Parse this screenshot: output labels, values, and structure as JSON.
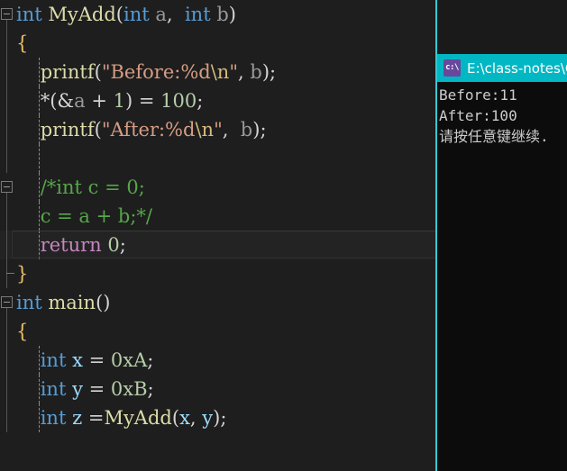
{
  "editor": {
    "name": "visual-studio-code-editor",
    "theme": "dark",
    "background": "#1e1e1e",
    "current_line_number": 9,
    "lines": [
      {
        "id": 1,
        "outline": "collapse",
        "indent_guide": false,
        "current": false,
        "tokens": [
          {
            "t": "int",
            "c": "t-keyword"
          },
          {
            "t": " ",
            "c": "t-plain"
          },
          {
            "t": "MyAdd",
            "c": "t-func"
          },
          {
            "t": "(",
            "c": "t-paren1"
          },
          {
            "t": "int",
            "c": "t-keyword"
          },
          {
            "t": " ",
            "c": "t-plain"
          },
          {
            "t": "a",
            "c": "t-param"
          },
          {
            "t": ",",
            "c": "t-plain"
          },
          {
            "t": "  ",
            "c": "t-plain"
          },
          {
            "t": "int",
            "c": "t-keyword"
          },
          {
            "t": " ",
            "c": "t-plain"
          },
          {
            "t": "b",
            "c": "t-param"
          },
          {
            "t": ")",
            "c": "t-paren1"
          }
        ]
      },
      {
        "id": 2,
        "outline": "line",
        "indent_guide": false,
        "current": false,
        "tokens": [
          {
            "t": "{",
            "c": "t-brace"
          }
        ]
      },
      {
        "id": 3,
        "outline": "line",
        "indent_guide": true,
        "current": false,
        "tokens": [
          {
            "t": "    ",
            "c": "t-plain"
          },
          {
            "t": "printf",
            "c": "t-func"
          },
          {
            "t": "(",
            "c": "t-paren1"
          },
          {
            "t": "\"Before:%d",
            "c": "t-string"
          },
          {
            "t": "\\n",
            "c": "t-escape"
          },
          {
            "t": "\"",
            "c": "t-string"
          },
          {
            "t": ",",
            "c": "t-plain"
          },
          {
            "t": " ",
            "c": "t-plain"
          },
          {
            "t": "b",
            "c": "t-param"
          },
          {
            "t": ")",
            "c": "t-paren1"
          },
          {
            "t": ";",
            "c": "t-plain"
          }
        ]
      },
      {
        "id": 4,
        "outline": "line",
        "indent_guide": true,
        "current": false,
        "tokens": [
          {
            "t": "    ",
            "c": "t-plain"
          },
          {
            "t": "*",
            "c": "t-plain"
          },
          {
            "t": "(",
            "c": "t-paren1"
          },
          {
            "t": "&",
            "c": "t-plain"
          },
          {
            "t": "a",
            "c": "t-param"
          },
          {
            "t": " + ",
            "c": "t-plain"
          },
          {
            "t": "1",
            "c": "t-number"
          },
          {
            "t": ")",
            "c": "t-paren1"
          },
          {
            "t": " = ",
            "c": "t-plain"
          },
          {
            "t": "100",
            "c": "t-number"
          },
          {
            "t": ";",
            "c": "t-plain"
          }
        ]
      },
      {
        "id": 5,
        "outline": "line",
        "indent_guide": true,
        "current": false,
        "tokens": [
          {
            "t": "    ",
            "c": "t-plain"
          },
          {
            "t": "printf",
            "c": "t-func"
          },
          {
            "t": "(",
            "c": "t-paren1"
          },
          {
            "t": "\"After:%d",
            "c": "t-string"
          },
          {
            "t": "\\n",
            "c": "t-escape"
          },
          {
            "t": "\"",
            "c": "t-string"
          },
          {
            "t": ",",
            "c": "t-plain"
          },
          {
            "t": "  ",
            "c": "t-plain"
          },
          {
            "t": "b",
            "c": "t-param"
          },
          {
            "t": ")",
            "c": "t-paren1"
          },
          {
            "t": ";",
            "c": "t-plain"
          }
        ]
      },
      {
        "id": 6,
        "outline": "line",
        "indent_guide": true,
        "current": false,
        "tokens": []
      },
      {
        "id": 7,
        "outline": "collapse",
        "indent_guide": true,
        "current": false,
        "tokens": [
          {
            "t": "    ",
            "c": "t-plain"
          },
          {
            "t": "/*int c = 0;",
            "c": "t-comment"
          }
        ]
      },
      {
        "id": 8,
        "outline": "line",
        "indent_guide": true,
        "current": false,
        "tokens": [
          {
            "t": "    ",
            "c": "t-plain"
          },
          {
            "t": "c = a + b;*/",
            "c": "t-comment"
          }
        ]
      },
      {
        "id": 9,
        "outline": "line",
        "indent_guide": true,
        "current": true,
        "tokens": [
          {
            "t": "    ",
            "c": "t-plain"
          },
          {
            "t": "return",
            "c": "t-ctrl"
          },
          {
            "t": " ",
            "c": "t-plain"
          },
          {
            "t": "0",
            "c": "t-number"
          },
          {
            "t": ";",
            "c": "t-plain"
          }
        ]
      },
      {
        "id": 10,
        "outline": "endbar",
        "indent_guide": false,
        "current": false,
        "tokens": [
          {
            "t": "}",
            "c": "t-brace"
          }
        ]
      },
      {
        "id": 11,
        "outline": "collapse",
        "indent_guide": false,
        "current": false,
        "tokens": [
          {
            "t": "int",
            "c": "t-keyword"
          },
          {
            "t": " ",
            "c": "t-plain"
          },
          {
            "t": "main",
            "c": "t-func"
          },
          {
            "t": "(",
            "c": "t-paren1"
          },
          {
            "t": ")",
            "c": "t-paren1"
          }
        ]
      },
      {
        "id": 12,
        "outline": "line",
        "indent_guide": false,
        "current": false,
        "tokens": [
          {
            "t": "{",
            "c": "t-brace"
          }
        ]
      },
      {
        "id": 13,
        "outline": "line",
        "indent_guide": true,
        "current": false,
        "tokens": [
          {
            "t": "    ",
            "c": "t-plain"
          },
          {
            "t": "int",
            "c": "t-keyword"
          },
          {
            "t": " ",
            "c": "t-plain"
          },
          {
            "t": "x",
            "c": "t-var"
          },
          {
            "t": " = ",
            "c": "t-plain"
          },
          {
            "t": "0xA",
            "c": "t-number"
          },
          {
            "t": ";",
            "c": "t-plain"
          }
        ]
      },
      {
        "id": 14,
        "outline": "line",
        "indent_guide": true,
        "current": false,
        "tokens": [
          {
            "t": "    ",
            "c": "t-plain"
          },
          {
            "t": "int",
            "c": "t-keyword"
          },
          {
            "t": " ",
            "c": "t-plain"
          },
          {
            "t": "y",
            "c": "t-var"
          },
          {
            "t": " = ",
            "c": "t-plain"
          },
          {
            "t": "0xB",
            "c": "t-number"
          },
          {
            "t": ";",
            "c": "t-plain"
          }
        ]
      },
      {
        "id": 15,
        "outline": "line",
        "indent_guide": true,
        "current": false,
        "tokens": [
          {
            "t": "    ",
            "c": "t-plain"
          },
          {
            "t": "int",
            "c": "t-keyword"
          },
          {
            "t": " ",
            "c": "t-plain"
          },
          {
            "t": "z",
            "c": "t-var"
          },
          {
            "t": " =",
            "c": "t-plain"
          },
          {
            "t": "MyAdd",
            "c": "t-func"
          },
          {
            "t": "(",
            "c": "t-paren1"
          },
          {
            "t": "x",
            "c": "t-var"
          },
          {
            "t": ", ",
            "c": "t-plain"
          },
          {
            "t": "y",
            "c": "t-var"
          },
          {
            "t": ")",
            "c": "t-paren1"
          },
          {
            "t": ";",
            "c": "t-plain"
          }
        ]
      }
    ]
  },
  "console": {
    "title": "E:\\class-notes\\C",
    "icon": "console-window-icon",
    "icon_glyph": "c:\\",
    "titlebar_color": "#00b7c3",
    "background": "#0c0c0c",
    "output": [
      "Before:11",
      "After:100",
      "请按任意键继续."
    ]
  }
}
